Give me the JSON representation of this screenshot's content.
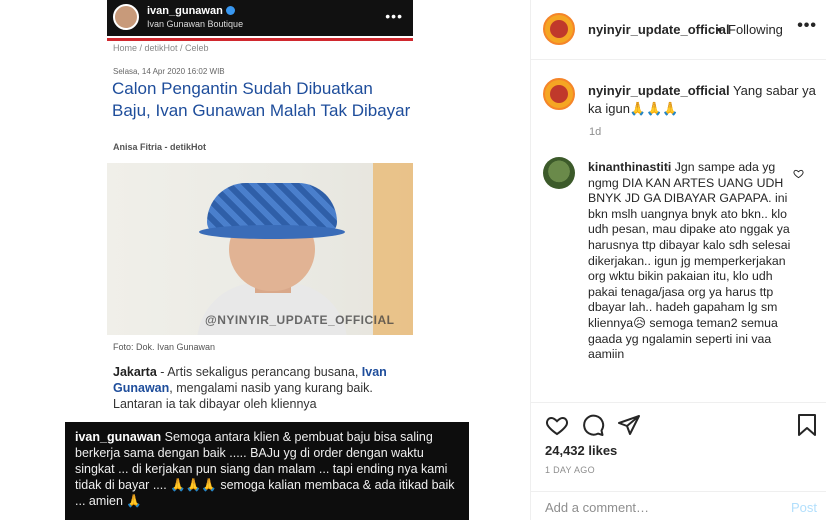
{
  "image": {
    "overlay_user": "ivan_gunawan",
    "overlay_subtitle": "Ivan Gunawan Boutique",
    "breadcrumb": "Home / detikHot / Celeb",
    "date": "Selasa, 14 Apr 2020 16:02 WIB",
    "title": "Calon Pengantin Sudah Dibuatkan Baju, Ivan Gunawan Malah Tak Dibayar",
    "author": "Anisa Fitria - detikHot",
    "watermark": "@NYINYIR_UPDATE_OFFICIAL",
    "photo_caption": "Foto: Dok. Ivan Gunawan",
    "body_city": "Jakarta",
    "body_1": " - Artis sekaligus perancang busana, ",
    "body_name": "Ivan Gunawan",
    "body_2": ", mengalami nasib yang kurang baik. Lantaran ia tak dibayar oleh kliennya",
    "quote_user": "ivan_gunawan",
    "quote_text": " Semoga  antara  klien & pembuat baju  bisa saling berkerja sama  dengan baik ..... BAJu yg di order dengan waktu singkat ... di kerjakan pun siang dan malam ... tapi ending nya kami tidak di bayar .... 🙏🙏🙏 semoga  kalian membaca & ada itikad baik ... amien 🙏"
  },
  "header": {
    "username": "nyinyir_update_official",
    "separator": "•",
    "follow_state": "Following",
    "more": "•••"
  },
  "caption": {
    "username": "nyinyir_update_official",
    "text": " Yang sabar ya ka igun🙏🙏🙏",
    "time": "1d"
  },
  "comment": {
    "username": "kinanthinastiti",
    "text": " Jgn sampe ada yg ngmg DIA KAN ARTES UANG UDH BNYK JD GA DIBAYAR GAPAPA. ini bkn mslh uangnya bnyk ato bkn.. klo udh pesan, mau dipake ato nggak ya harusnya ttp dibayar kalo sdh selesai dikerjakan.. igun jg memperkerjakan org wktu bikin pakaian itu, klo udh pakai tenaga/jasa org ya harus ttp dbayar lah.. hadeh gapaham lg sm kliennya😥 semoga teman2 semua gaada yg ngalamin seperti ini vaa aamiin"
  },
  "footer": {
    "likes": "24,432 likes",
    "date": "1 DAY AGO",
    "add_comment_placeholder": "Add a comment…",
    "post_label": "Post"
  }
}
